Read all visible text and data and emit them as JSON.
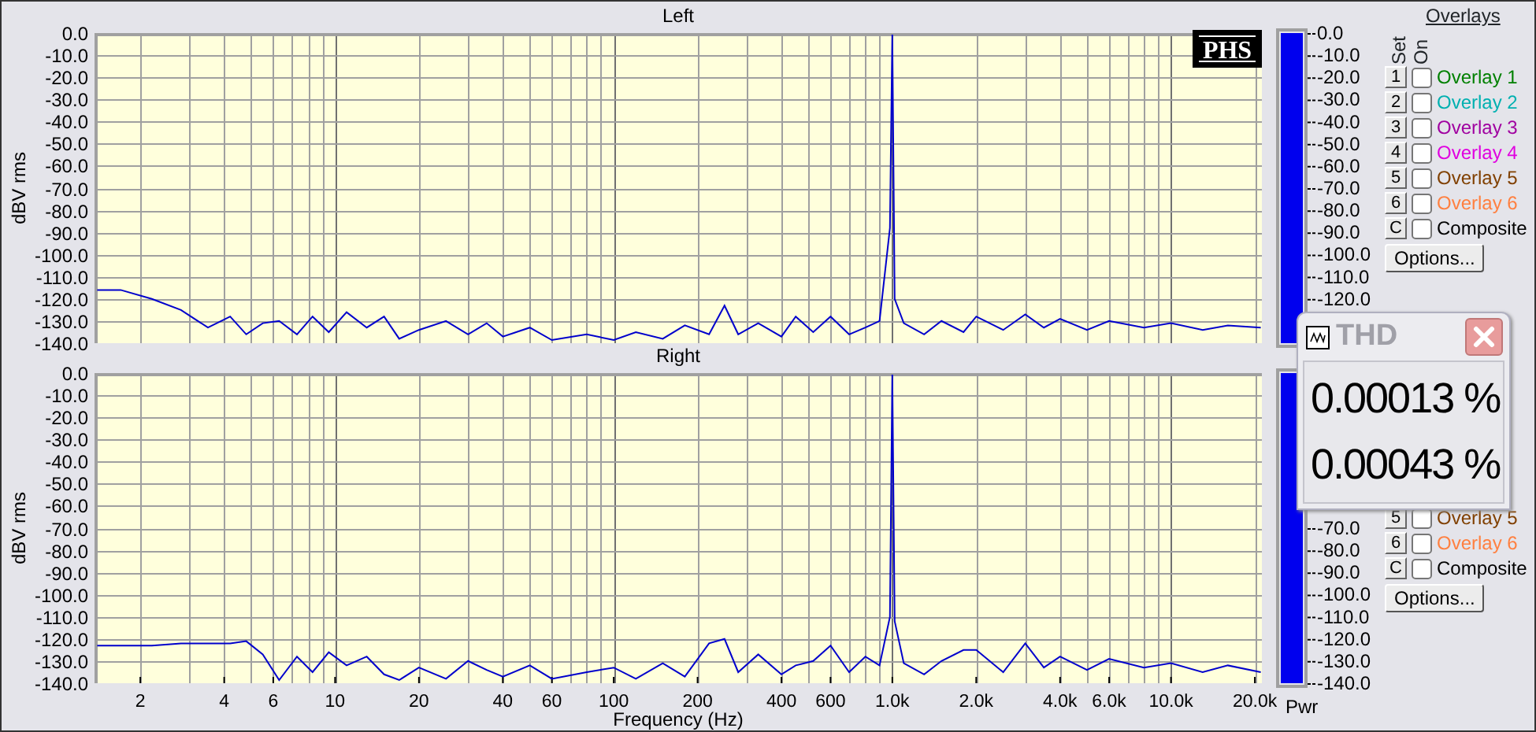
{
  "panels": [
    {
      "plot": {
        "title": "Left",
        "ylabel": "dBV rms",
        "y_tick_labels": [
          "0.0",
          "-10.0",
          "-20.0",
          "-30.0",
          "-40.0",
          "-50.0",
          "-60.0",
          "-70.0",
          "-80.0",
          "-90.0",
          "-100.0",
          "-110.0",
          "-120.0",
          "-130.0",
          "-140.0"
        ]
      },
      "logo": "PHS",
      "meter": {
        "level": 1,
        "labels": [
          "0.0",
          "-10.0",
          "-20.0",
          "-30.0",
          "-40.0",
          "-50.0",
          "-60.0",
          "-70.0",
          "-80.0",
          "-90.0",
          "-100.0",
          "-110.0",
          "-120.0"
        ]
      },
      "overlays": {
        "heading": "Overlays",
        "set_label": "Set",
        "on_label": "On",
        "items": [
          {
            "key": "1",
            "label": "Overlay 1",
            "color": "#008000",
            "checked": false
          },
          {
            "key": "2",
            "label": "Overlay 2",
            "color": "#00b0b0",
            "checked": false
          },
          {
            "key": "3",
            "label": "Overlay 3",
            "color": "#a000a0",
            "checked": false
          },
          {
            "key": "4",
            "label": "Overlay 4",
            "color": "#e000e0",
            "checked": false
          },
          {
            "key": "5",
            "label": "Overlay 5",
            "color": "#804000",
            "checked": false
          },
          {
            "key": "6",
            "label": "Overlay 6",
            "color": "#ff8040",
            "checked": false
          },
          {
            "key": "C",
            "label": "Composite",
            "color": "#000000",
            "checked": false
          }
        ],
        "options": "Options..."
      }
    },
    {
      "plot": {
        "title": "Right",
        "ylabel": "dBV rms",
        "xlabel": "Frequency (Hz)",
        "y_tick_labels": [
          "0.0",
          "-10.0",
          "-20.0",
          "-30.0",
          "-40.0",
          "-50.0",
          "-60.0",
          "-70.0",
          "-80.0",
          "-90.0",
          "-100.0",
          "-110.0",
          "-120.0",
          "-130.0",
          "-140.0"
        ],
        "x_tick_labels": [
          "2",
          "4",
          "6",
          "10",
          "20",
          "40",
          "60",
          "100",
          "200",
          "400",
          "600",
          "1.0k",
          "2.0k",
          "4.0k",
          "6.0k",
          "10.0k",
          "20.0k"
        ]
      },
      "meter": {
        "level": 1,
        "labels": [
          "-70.0",
          "-80.0",
          "-90.0",
          "-100.0",
          "-110.0",
          "-120.0",
          "-130.0",
          "-140.0"
        ]
      },
      "overlays": {
        "items": [
          {
            "key": "5",
            "label": "Overlay 5",
            "color": "#804000",
            "checked": false
          },
          {
            "key": "6",
            "label": "Overlay 6",
            "color": "#ff8040",
            "checked": false
          },
          {
            "key": "C",
            "label": "Composite",
            "color": "#000000",
            "checked": false
          }
        ],
        "options": "Options..."
      }
    }
  ],
  "pwr_label": "Pwr",
  "thd_window": {
    "title": "THD",
    "values": [
      "0.00013 %",
      "0.00043 %"
    ]
  }
}
